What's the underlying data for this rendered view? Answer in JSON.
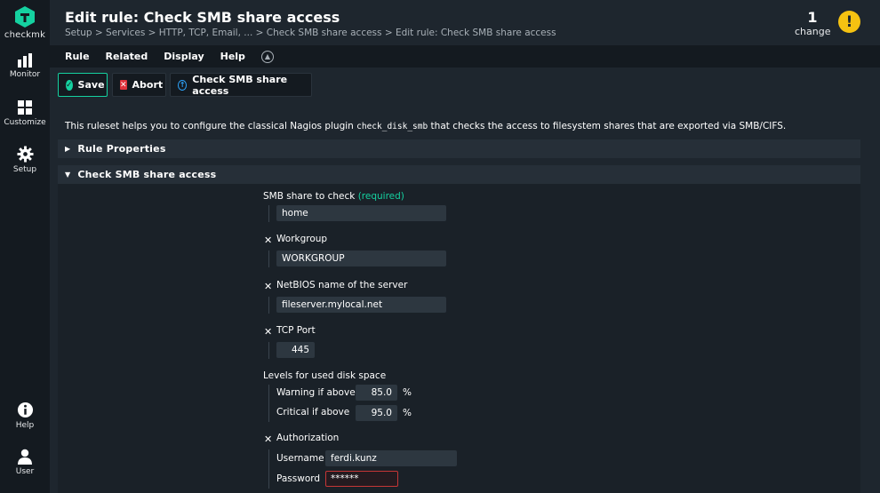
{
  "nav": {
    "logo": "checkmk",
    "items": [
      {
        "label": "Monitor",
        "icon": "bar-chart-icon"
      },
      {
        "label": "Customize",
        "icon": "grid-icon"
      },
      {
        "label": "Setup",
        "icon": "gear-icon"
      },
      {
        "label": "Help",
        "icon": "info-icon"
      },
      {
        "label": "User",
        "icon": "user-icon"
      }
    ]
  },
  "header": {
    "title": "Edit rule: Check SMB share access",
    "breadcrumb": "Setup > Services > HTTP, TCP, Email, ... > Check SMB share access > Edit rule: Check SMB share access",
    "changes_count": "1",
    "changes_label": "change",
    "warning_glyph": "!"
  },
  "menubar": {
    "items": [
      "Rule",
      "Related",
      "Display",
      "Help"
    ]
  },
  "toolbar": {
    "save_label": "Save",
    "abort_label": "Abort",
    "ruleset_label": "Check SMB share access"
  },
  "description": {
    "before": "This ruleset helps you to configure the classical Nagios plugin ",
    "code": "check_disk_smb",
    "after": " that checks the access to filesystem shares that are exported via SMB/CIFS."
  },
  "sections": {
    "rule_properties": "Rule Properties",
    "check_smb": "Check SMB share access"
  },
  "form": {
    "share_label": "SMB share to check",
    "share_required": "(required)",
    "share_value": "home",
    "workgroup_label": "Workgroup",
    "workgroup_value": "WORKGROUP",
    "netbios_label": "NetBIOS name of the server",
    "netbios_value": "fileserver.mylocal.net",
    "port_label": "TCP Port",
    "port_value": "445",
    "levels_label": "Levels for used disk space",
    "warn_label": "Warning if above",
    "warn_value": "85.0",
    "crit_label": "Critical if above",
    "crit_value": "95.0",
    "percent": "%",
    "auth_label": "Authorization",
    "username_label": "Username",
    "username_value": "ferdi.kunz",
    "password_label": "Password",
    "password_value": "******"
  },
  "colors": {
    "accent_green": "#15d1a0",
    "abort_red": "#e0323c",
    "warning_yellow": "#f5c211",
    "background": "#1e262e"
  }
}
